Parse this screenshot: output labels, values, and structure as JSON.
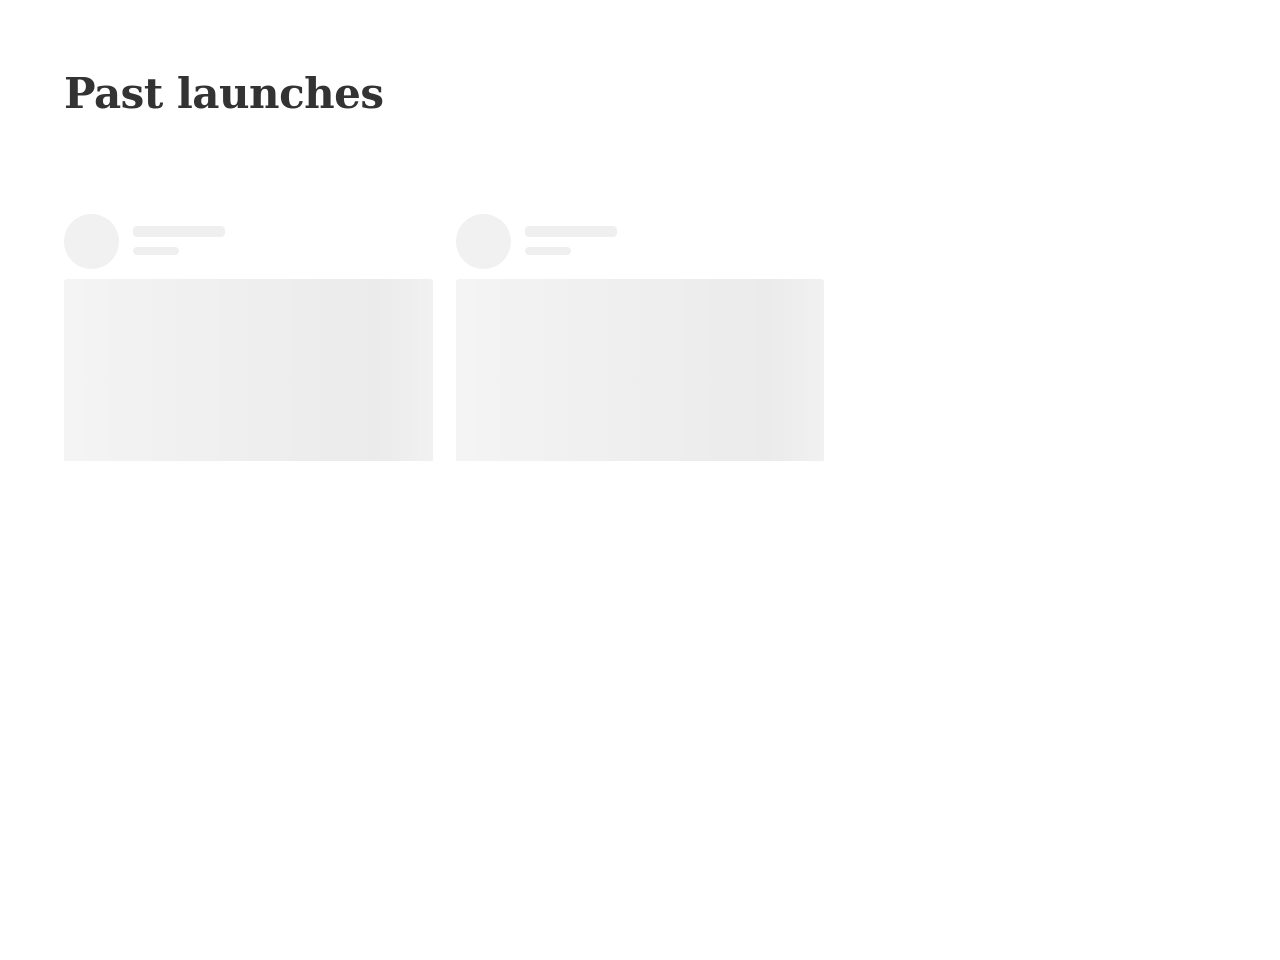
{
  "header": {
    "title": "Past launches"
  },
  "launches": {
    "loading": true,
    "placeholder_count": 2
  },
  "colors": {
    "title": "#333333",
    "skeleton": "#f1f1f1",
    "background": "#ffffff"
  }
}
